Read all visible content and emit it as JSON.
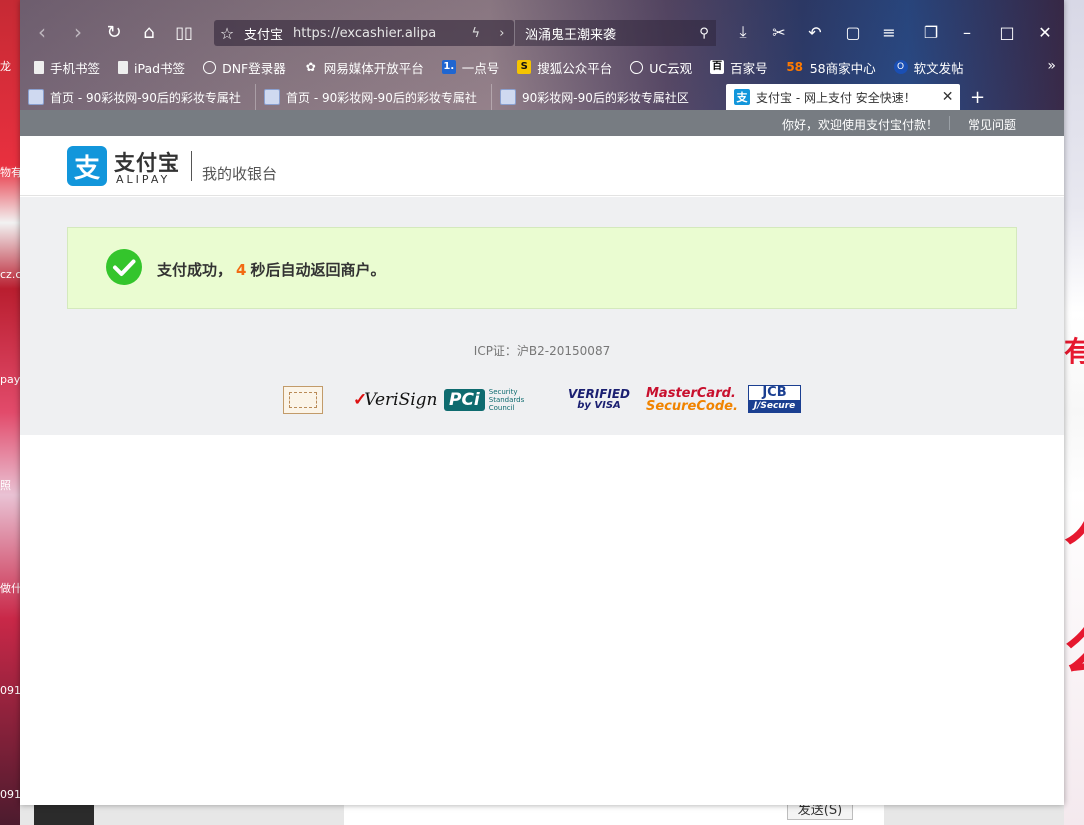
{
  "browser": {
    "address": {
      "site_name": "支付宝",
      "url": "https://excashier.alipa"
    },
    "search": {
      "text": "汹涌鬼王潮来袭"
    },
    "bookmarks": [
      {
        "label": "手机书签",
        "icon": "doc-icon"
      },
      {
        "label": "iPad书签",
        "icon": "doc-icon"
      },
      {
        "label": "DNF登录器",
        "icon": "globe-icon"
      },
      {
        "label": "网易媒体开放平台",
        "icon": "netease-icon"
      },
      {
        "label": "一点号",
        "icon_text": "1.",
        "icon": "yidian-icon"
      },
      {
        "label": "搜狐公众平台",
        "icon_text": "S",
        "icon": "sohu-icon"
      },
      {
        "label": "UC云观",
        "icon": "globe-icon"
      },
      {
        "label": "百家号",
        "icon_text": "百",
        "icon": "baijia-icon"
      },
      {
        "label": "58商家中心",
        "icon_text": "58",
        "icon": "58-icon"
      },
      {
        "label": "软文发帖",
        "icon_text": "O",
        "icon": "ruanwen-icon"
      }
    ],
    "tabs": [
      {
        "label": "首页 - 90彩妆网-90后的彩妆专属社",
        "active": false
      },
      {
        "label": "首页 - 90彩妆网-90后的彩妆专属社",
        "active": false
      },
      {
        "label": "90彩妆网-90后的彩妆专属社区",
        "active": false
      },
      {
        "label": "支付宝 - 网上支付 安全快速！",
        "active": true,
        "favicon_text": "支"
      }
    ]
  },
  "page": {
    "topbar": {
      "welcome": "你好，欢迎使用支付宝付款！",
      "faq": "常见问题"
    },
    "header": {
      "logo_cn": "支付宝",
      "logo_en": "ALIPAY",
      "logo_mark": "支",
      "subtitle": "我的收银台"
    },
    "success": {
      "prefix": "支付成功，",
      "seconds": "4",
      "suffix": "秒后自动返回商户。"
    },
    "icp": "ICP证：沪B2-20150087",
    "certs": {
      "verisign": "VeriSign",
      "verisign_tick": "✓",
      "pci": "PCi",
      "pci_sub": "Security Standards Council",
      "visa_line1": "VERIFIED",
      "visa_line2": "by VISA",
      "mc_line1": "MasterCard.",
      "mc_line2": "SecureCode.",
      "jcb_line1": "JCB",
      "jcb_line2": "J/Secure"
    }
  },
  "desktop": {
    "send_button": "发送(S)",
    "left_labels": [
      "龙",
      "物有",
      "cz.c",
      "pay",
      "照",
      "做什",
      "091",
      "091"
    ],
    "right_labels": [
      "有",
      "人",
      "么"
    ]
  },
  "colors": {
    "alipay_blue": "#1296db",
    "success_bg": "#eafcd1",
    "success_green": "#34c52c",
    "countdown_orange": "#f26a12",
    "topbar_gray": "#777c82"
  }
}
